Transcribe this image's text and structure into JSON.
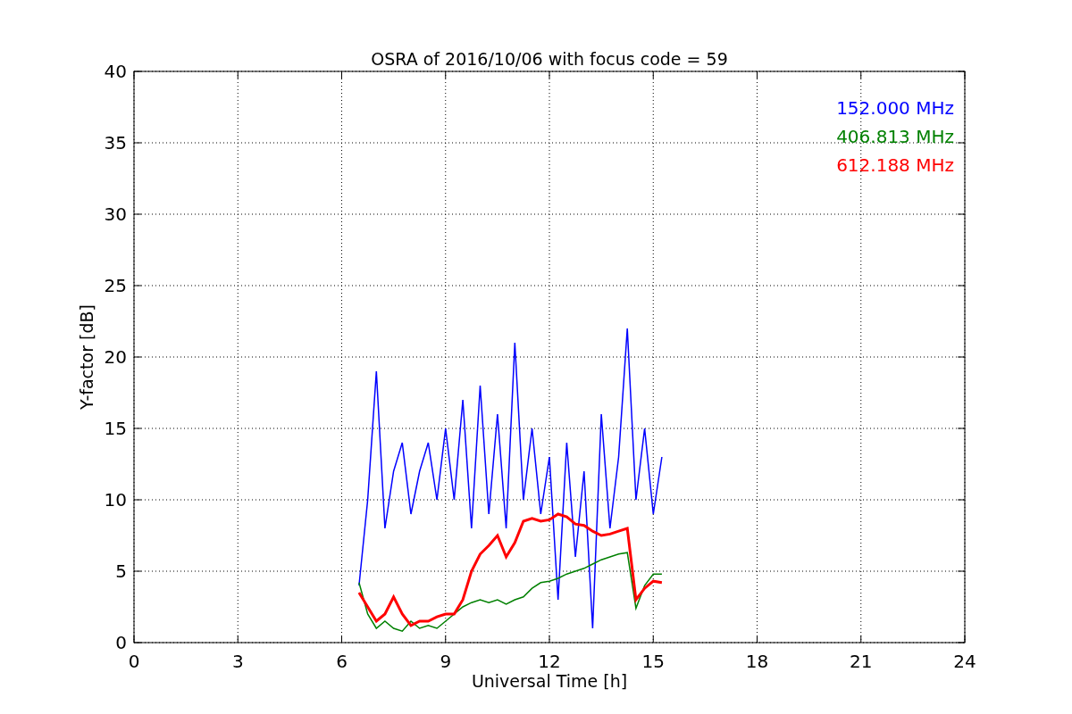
{
  "chart": {
    "chart_data": {
      "type": "line",
      "title": "OSRA of 2016/10/06 with focus code = 59",
      "xlabel": "Universal Time [h]",
      "ylabel": "Y-factor [dB]",
      "x": [
        6.5,
        6.75,
        7,
        7.25,
        7.5,
        7.75,
        8,
        8.25,
        8.5,
        8.75,
        9,
        9.25,
        9.5,
        9.75,
        10,
        10.25,
        10.5,
        10.75,
        11,
        11.25,
        11.5,
        11.75,
        12,
        12.25,
        12.5,
        12.75,
        13,
        13.25,
        13.5,
        13.75,
        14,
        14.25,
        14.5,
        14.75,
        15,
        15.25
      ],
      "series": [
        {
          "name": "152.000 MHz",
          "color": "#0000ff",
          "values": [
            4,
            10,
            19,
            8,
            12,
            14,
            9,
            12,
            14,
            10,
            15,
            10,
            17,
            8,
            18,
            9,
            16,
            8,
            21,
            10,
            15,
            9,
            13,
            3,
            14,
            6,
            12,
            1,
            16,
            8,
            13,
            22,
            10,
            15,
            9,
            13
          ]
        },
        {
          "name": "406.813 MHz",
          "color": "#008000",
          "values": [
            4.2,
            2,
            1,
            1.5,
            1,
            0.8,
            1.5,
            1,
            1.2,
            1,
            1.5,
            2,
            2.5,
            2.8,
            3,
            2.8,
            3,
            2.7,
            3,
            3.2,
            3.8,
            4.2,
            4.3,
            4.5,
            4.8,
            5,
            5.2,
            5.5,
            5.8,
            6,
            6.2,
            6.3,
            2.4,
            4,
            4.8,
            4.8
          ]
        },
        {
          "name": "612.188 MHz",
          "color": "#ff0000",
          "values": [
            3.5,
            2.5,
            1.5,
            2,
            3.2,
            2,
            1.2,
            1.5,
            1.5,
            1.8,
            2,
            2,
            3,
            5,
            6.2,
            6.8,
            7.5,
            6,
            7,
            8.5,
            8.7,
            8.5,
            8.6,
            9,
            8.8,
            8.3,
            8.2,
            7.8,
            7.5,
            7.6,
            7.8,
            8,
            3,
            3.8,
            4.3,
            4.2
          ]
        }
      ],
      "xlim": [
        0,
        24
      ],
      "ylim": [
        0,
        40
      ],
      "xticks": [
        0,
        3,
        6,
        9,
        12,
        15,
        18,
        21,
        24
      ],
      "yticks": [
        0,
        5,
        10,
        15,
        20,
        25,
        30,
        35,
        40
      ],
      "grid": true
    }
  }
}
